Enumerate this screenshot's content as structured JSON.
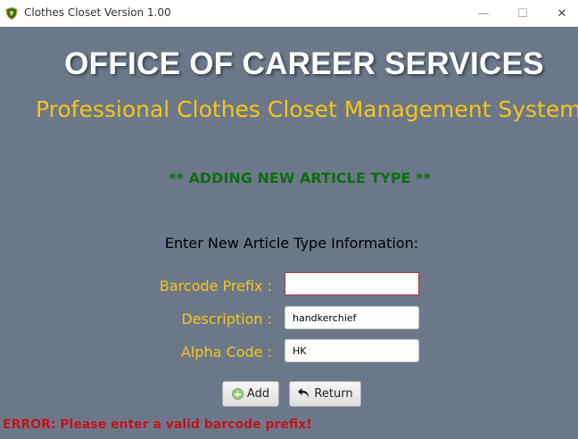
{
  "window": {
    "title": "Clothes Closet Version 1.00",
    "icon": "shield-crest-icon",
    "controls": {
      "minimize": "—",
      "maximize": "☐",
      "close": "✕"
    }
  },
  "header": {
    "office": "OFFICE OF CAREER SERVICES",
    "system": "Professional Clothes Closet Management System"
  },
  "mode": "** ADDING NEW ARTICLE TYPE **",
  "form": {
    "prompt": "Enter New Article Type Information:",
    "barcode_prefix": {
      "label": "Barcode Prefix :",
      "value": ""
    },
    "description": {
      "label": "Description :",
      "value": "handkerchief"
    },
    "alpha_code": {
      "label": "Alpha Code :",
      "value": "HK"
    }
  },
  "buttons": {
    "add": {
      "label": "Add",
      "icon": "add-circle-icon"
    },
    "return": {
      "label": "Return",
      "icon": "return-arrow-icon"
    }
  },
  "status": {
    "error": "ERROR: Please enter a valid barcode prefix!"
  },
  "colors": {
    "background": "#6c7889",
    "title_white": "#ffffff",
    "subtitle_gold": "#f5c518",
    "mode_green": "#0f6b14",
    "error_red": "#c0151b"
  }
}
